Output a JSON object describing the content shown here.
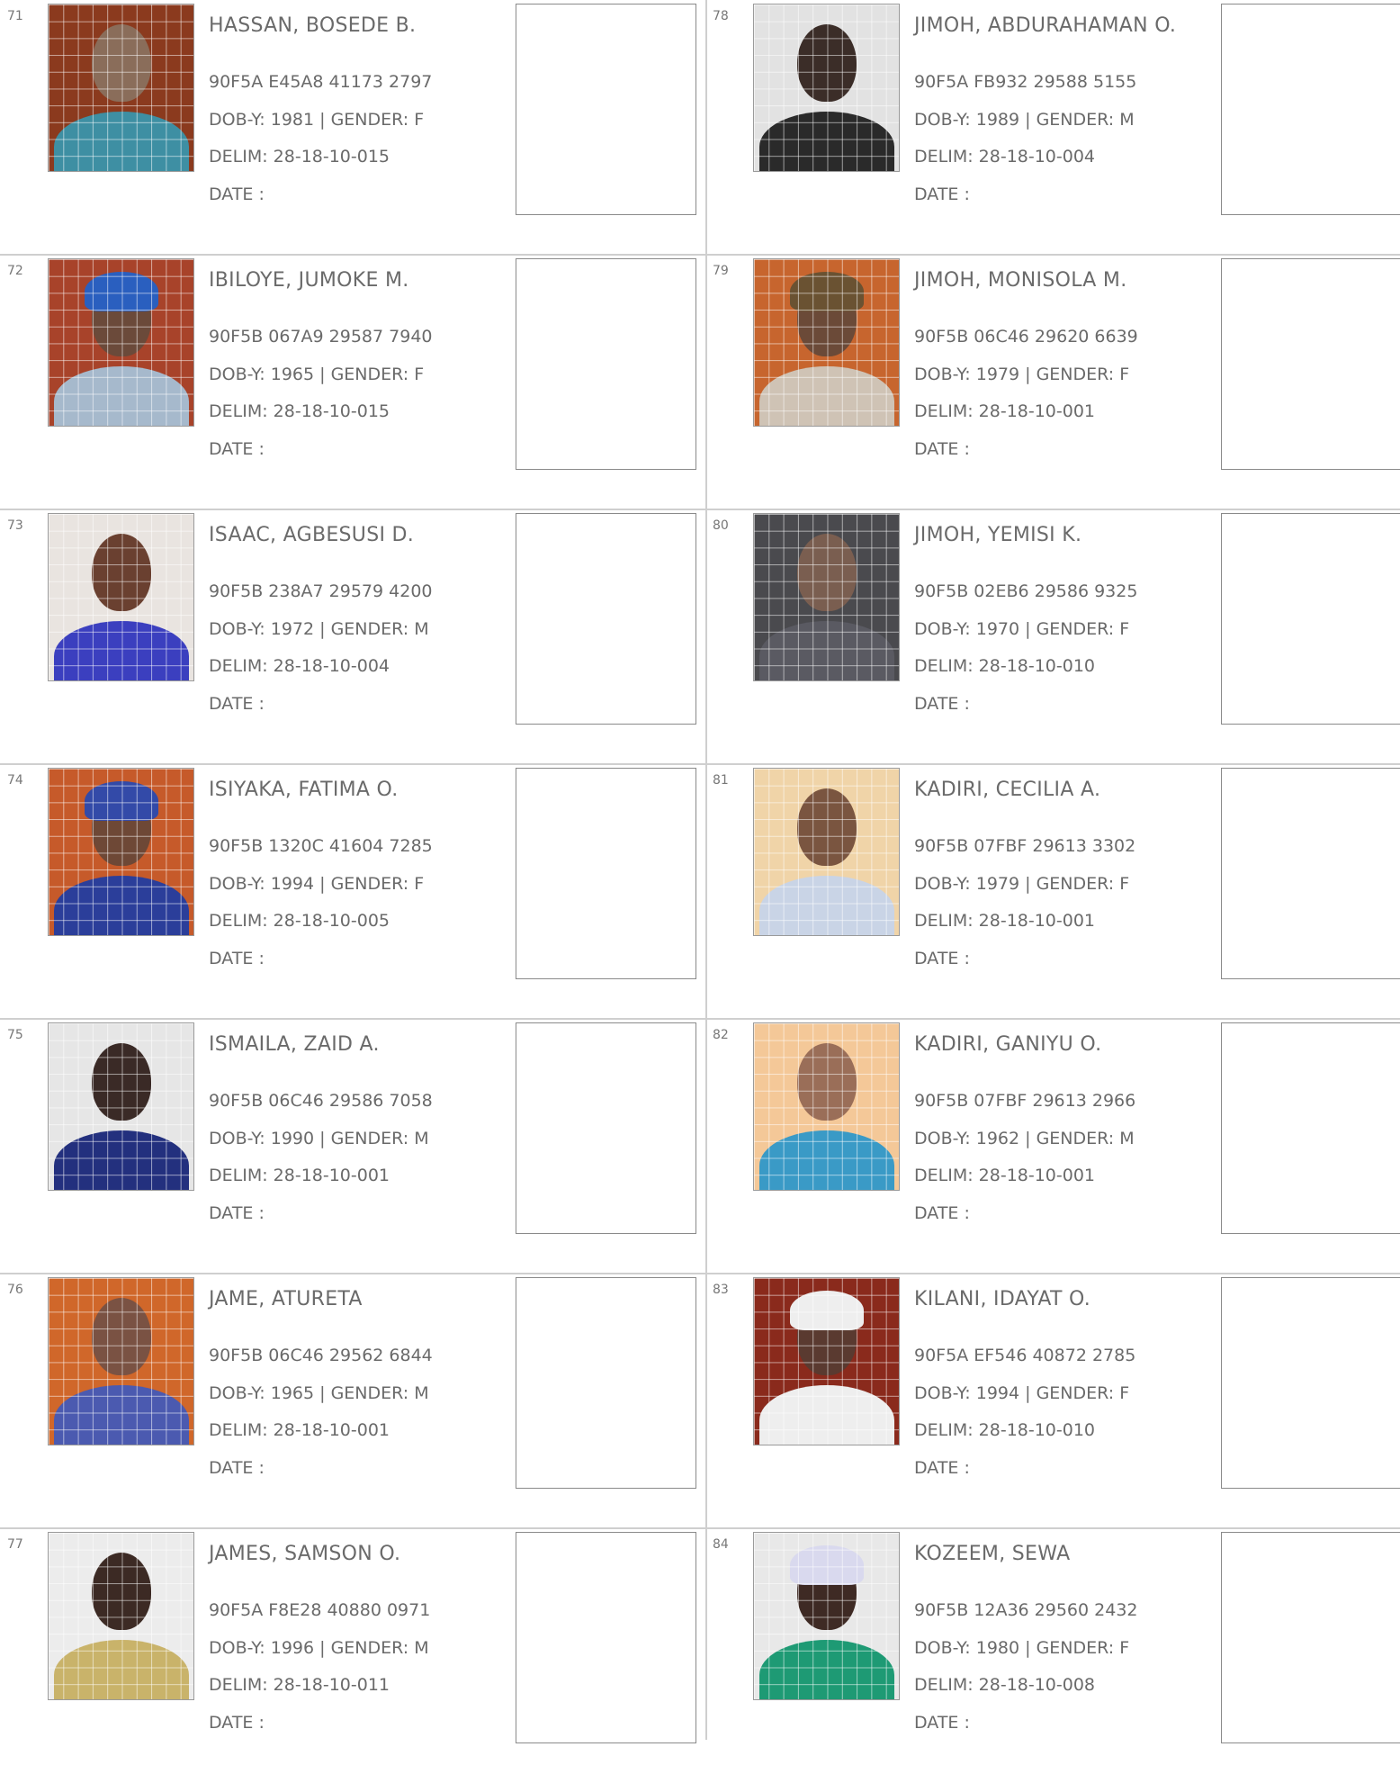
{
  "columns": [
    {
      "records": [
        {
          "no": "71",
          "name": "HASSAN, BOSEDE B.",
          "nin": "90F5A E45A8 41173 2797",
          "dob_gender": "DOB-Y: 1981 | GENDER: F",
          "delim": "DELIM: 28-18-10-015",
          "date": "DATE :",
          "photo": {
            "bg": "#8b3a1e",
            "skin": "#8a6d5a",
            "cloth": "#3e8fa3"
          }
        },
        {
          "no": "72",
          "name": "IBILOYE, JUMOKE M.",
          "nin": "90F5B 067A9 29587 7940",
          "dob_gender": "DOB-Y: 1965 | GENDER: F",
          "delim": "DELIM: 28-18-10-015",
          "date": "DATE :",
          "photo": {
            "bg": "#a8432a",
            "skin": "#6b4a3a",
            "cloth": "#a6b9cc",
            "hat": "#2a5fbf"
          }
        },
        {
          "no": "73",
          "name": "ISAAC, AGBESUSI D.",
          "nin": "90F5B 238A7 29579 4200",
          "dob_gender": "DOB-Y: 1972 | GENDER: M",
          "delim": "DELIM: 28-18-10-004",
          "date": "DATE :",
          "photo": {
            "bg": "#e9e4e0",
            "skin": "#6a4030",
            "cloth": "#3b3fbf"
          }
        },
        {
          "no": "74",
          "name": "ISIYAKA, FATIMA O.",
          "nin": "90F5B 1320C 41604 7285",
          "dob_gender": "DOB-Y: 1994 | GENDER: F",
          "delim": "DELIM: 28-18-10-005",
          "date": "DATE :",
          "photo": {
            "bg": "#c65a2a",
            "skin": "#6e4836",
            "cloth": "#2b3e9a",
            "hat": "#334aa8"
          }
        },
        {
          "no": "75",
          "name": "ISMAILA, ZAID A.",
          "nin": "90F5B 06C46 29586 7058",
          "dob_gender": "DOB-Y: 1990 | GENDER: M",
          "delim": "DELIM: 28-18-10-001",
          "date": "DATE :",
          "photo": {
            "bg": "#e6e6e6",
            "skin": "#3a2a26",
            "cloth": "#23307e"
          }
        },
        {
          "no": "76",
          "name": "JAME, ATURETA",
          "nin": "90F5B 06C46 29562 6844",
          "dob_gender": "DOB-Y: 1965 | GENDER: M",
          "delim": "DELIM: 28-18-10-001",
          "date": "DATE :",
          "photo": {
            "bg": "#d0672a",
            "skin": "#7a5243",
            "cloth": "#4b5ab0"
          }
        },
        {
          "no": "77",
          "name": "JAMES, SAMSON O.",
          "nin": "90F5A F8E28 40880 0971",
          "dob_gender": "DOB-Y: 1996 | GENDER: M",
          "delim": "DELIM: 28-18-10-011",
          "date": "DATE :",
          "photo": {
            "bg": "#ececec",
            "skin": "#3c2a24",
            "cloth": "#c9b36a"
          }
        }
      ]
    },
    {
      "records": [
        {
          "no": "78",
          "name": "JIMOH, ABDURAHAMAN O.",
          "nin": "90F5A FB932 29588 5155",
          "dob_gender": "DOB-Y: 1989 | GENDER: M",
          "delim": "DELIM: 28-18-10-004",
          "date": "DATE :",
          "photo": {
            "bg": "#e2e2e2",
            "skin": "#3b2d28",
            "cloth": "#2a2a2a"
          }
        },
        {
          "no": "79",
          "name": "JIMOH, MONISOLA M.",
          "nin": "90F5B 06C46 29620 6639",
          "dob_gender": "DOB-Y: 1979 | GENDER: F",
          "delim": "DELIM: 28-18-10-001",
          "date": "DATE :",
          "photo": {
            "bg": "#c7652e",
            "skin": "#6b4a38",
            "cloth": "#cfc3b5",
            "hat": "#6a5232"
          }
        },
        {
          "no": "80",
          "name": "JIMOH, YEMISI K.",
          "nin": "90F5B 02EB6 29586 9325",
          "dob_gender": "DOB-Y: 1970 | GENDER: F",
          "delim": "DELIM: 28-18-10-010",
          "date": "DATE :",
          "photo": {
            "bg": "#4a4a4e",
            "skin": "#7a5e50",
            "cloth": "#5a5a62"
          }
        },
        {
          "no": "81",
          "name": "KADIRI, CECILIA A.",
          "nin": "90F5B 07FBF 29613 3302",
          "dob_gender": "DOB-Y: 1979 | GENDER: F",
          "delim": "DELIM: 28-18-10-001",
          "date": "DATE :",
          "photo": {
            "bg": "#f0d4a8",
            "skin": "#7a5540",
            "cloth": "#c9d4e6"
          }
        },
        {
          "no": "82",
          "name": "KADIRI, GANIYU O.",
          "nin": "90F5B 07FBF 29613 2966",
          "dob_gender": "DOB-Y: 1962 | GENDER: M",
          "delim": "DELIM: 28-18-10-001",
          "date": "DATE :",
          "photo": {
            "bg": "#f4c898",
            "skin": "#9a6e58",
            "cloth": "#3a9ac6"
          }
        },
        {
          "no": "83",
          "name": "KILANI, IDAYAT O.",
          "nin": "90F5A EF546 40872 2785",
          "dob_gender": "DOB-Y: 1994 | GENDER: F",
          "delim": "DELIM: 28-18-10-010",
          "date": "DATE :",
          "photo": {
            "bg": "#8a2a1c",
            "skin": "#5a3a30",
            "cloth": "#eeeeee",
            "hat": "#eeeeee"
          }
        },
        {
          "no": "84",
          "name": "KOZEEM, SEWA",
          "nin": "90F5B 12A36 29560 2432",
          "dob_gender": "DOB-Y: 1980 | GENDER: F",
          "delim": "DELIM: 28-18-10-008",
          "date": "DATE :",
          "photo": {
            "bg": "#e8e8e8",
            "skin": "#3e2a24",
            "cloth": "#1e9a74",
            "hat": "#d9d9ee"
          }
        }
      ]
    }
  ]
}
